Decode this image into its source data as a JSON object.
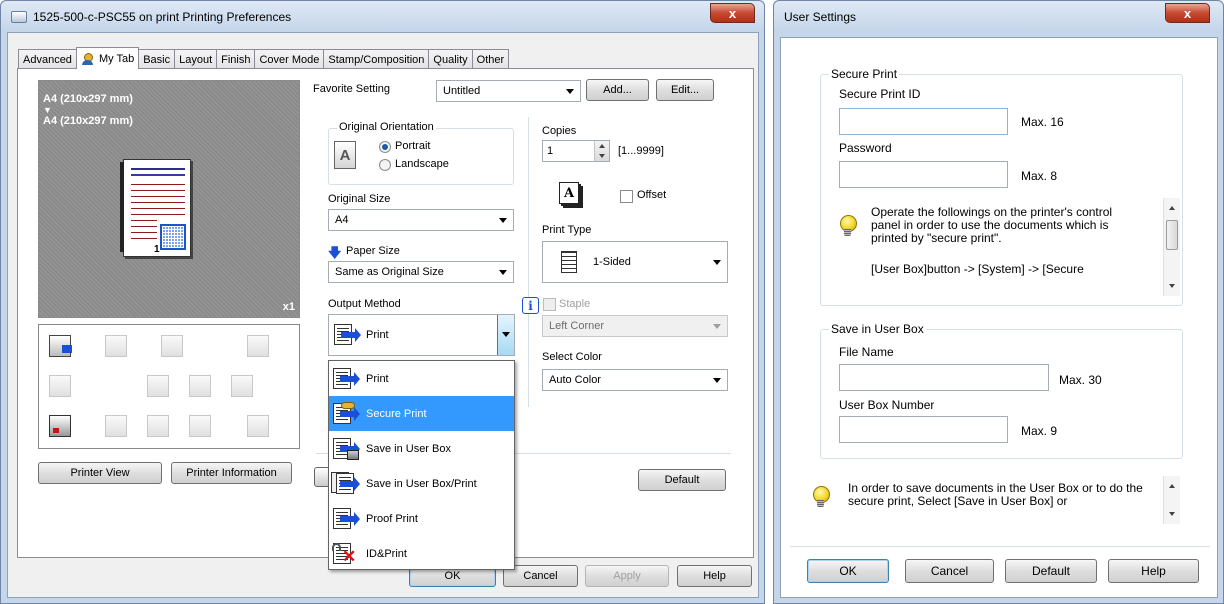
{
  "main_window": {
    "title": "1525-500-c-PSC55 on print Printing Preferences",
    "close": "x",
    "tabs": [
      "Advanced",
      "My Tab",
      "Basic",
      "Layout",
      "Finish",
      "Cover Mode",
      "Stamp/Composition",
      "Quality",
      "Other"
    ],
    "active_tab": "My Tab",
    "preview": {
      "line1": "A4 (210x297 mm)",
      "arrow": "▼",
      "line2": "A4 (210x297 mm)",
      "page_number": "1",
      "count": "x1"
    },
    "printer_view_button": "Printer View",
    "printer_information_button": "Printer Information",
    "favorite_setting_label": "Favorite Setting",
    "favorite_setting_value": "Untitled",
    "add_button": "Add...",
    "edit_button": "Edit...",
    "original_orientation_label": "Original Orientation",
    "portrait_label": "Portrait",
    "landscape_label": "Landscape",
    "orientation_selected": "Portrait",
    "original_size_label": "Original Size",
    "original_size_value": "A4",
    "paper_size_label": "Paper Size",
    "paper_size_value": "Same as Original Size",
    "output_method_label": "Output Method",
    "output_method_value": "Print",
    "output_method_options": [
      "Print",
      "Secure Print",
      "Save in User Box",
      "Save in User Box/Print",
      "Proof Print",
      "ID&Print"
    ],
    "output_method_highlighted": "Secure Print",
    "copies_label": "Copies",
    "copies_value": "1",
    "copies_range": "[1...9999]",
    "offset_label": "Offset",
    "print_type_label": "Print Type",
    "print_type_value": "1-Sided",
    "staple_label": "Staple",
    "staple_value": "Left Corner",
    "select_color_label": "Select Color",
    "select_color_value": "Auto Color",
    "default_button": "Default",
    "ok_button": "OK",
    "cancel_button": "Cancel",
    "apply_button": "Apply",
    "help_button": "Help"
  },
  "user_settings": {
    "title": "User Settings",
    "close": "x",
    "secure_print_group": "Secure Print",
    "secure_print_id_label": "Secure Print ID",
    "secure_print_id_value": "",
    "secure_print_id_max": "Max. 16",
    "password_label": "Password",
    "password_value": "",
    "password_max": "Max. 8",
    "secure_info_text": "Operate the followings on the printer's control panel in order to use the documents which is printed by \"secure print\".",
    "secure_info_text2": "[User Box]button -> [System] -> [Secure",
    "save_in_user_box_group": "Save in User Box",
    "file_name_label": "File Name",
    "file_name_value": "",
    "file_name_max": "Max. 30",
    "user_box_number_label": "User Box Number",
    "user_box_number_value": "",
    "user_box_number_max": "Max. 9",
    "bottom_info_text": "In order to save documents in the User Box or to do the secure print, Select [Save in User Box] or",
    "ok_button": "OK",
    "cancel_button": "Cancel",
    "default_button": "Default",
    "help_button": "Help"
  }
}
